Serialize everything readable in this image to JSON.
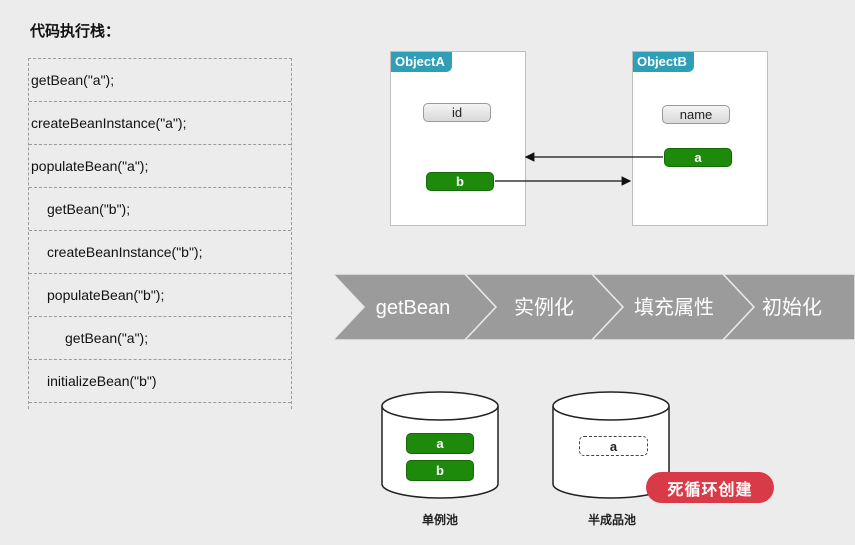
{
  "stack": {
    "title": "代码执行栈：",
    "rows": [
      "getBean(\"a\");",
      "createBeanInstance(\"a\");",
      "populateBean(\"a\");",
      "getBean(\"b\");",
      "createBeanInstance(\"b\");",
      "populateBean(\"b\");",
      "getBean(\"a\");",
      "initializeBean(\"b\")"
    ]
  },
  "objects": {
    "a": {
      "name": "ObjectA",
      "fields": [
        "id",
        "b"
      ]
    },
    "b": {
      "name": "ObjectB",
      "fields": [
        "name",
        "a"
      ]
    }
  },
  "flow": {
    "steps": [
      "getBean",
      "实例化",
      "填充属性",
      "初始化"
    ],
    "color": "#9b9b9b"
  },
  "pools": {
    "singleton": {
      "label": "单例池",
      "items": [
        "a",
        "b"
      ]
    },
    "early": {
      "label": "半成品池",
      "items": [
        "a"
      ]
    }
  },
  "badge": {
    "text": "死循环创建",
    "color": "#d93a48"
  },
  "colors": {
    "green": "#1d8a0c",
    "tag": "#2e9fb6"
  }
}
